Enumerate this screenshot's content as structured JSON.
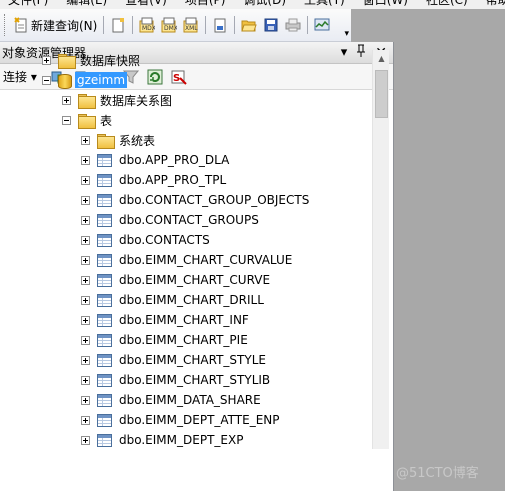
{
  "menu": [
    "文件(F)",
    "编辑(E)",
    "查看(V)",
    "项目(P)",
    "调试(D)",
    "工具(T)",
    "窗口(W)",
    "社区(C)",
    "帮助(H)"
  ],
  "toolbar": {
    "new_query_label": "新建查询(N)"
  },
  "panel": {
    "title": "对象资源管理器",
    "pin_glyph": "▾ 卩",
    "close_glyph": "✕",
    "connect_label": "连接 ▾"
  },
  "tree": {
    "db_snapshots": "数据库快照",
    "database": "gzeimm",
    "diagrams": "数据库关系图",
    "tables_folder": "表",
    "system_tables": "系统表",
    "tables": [
      "dbo.APP_PRO_DLA",
      "dbo.APP_PRO_TPL",
      "dbo.CONTACT_GROUP_OBJECTS",
      "dbo.CONTACT_GROUPS",
      "dbo.CONTACTS",
      "dbo.EIMM_CHART_CURVALUE",
      "dbo.EIMM_CHART_CURVE",
      "dbo.EIMM_CHART_DRILL",
      "dbo.EIMM_CHART_INF",
      "dbo.EIMM_CHART_PIE",
      "dbo.EIMM_CHART_STYLE",
      "dbo.EIMM_CHART_STYLIB",
      "dbo.EIMM_DATA_SHARE",
      "dbo.EIMM_DEPT_ATTE_ENP",
      "dbo.EIMM_DEPT_EXP"
    ]
  },
  "watermark": "@51CTO博客",
  "colors": {
    "selection": "#3399ff",
    "background_gray": "#a8a8a8"
  }
}
